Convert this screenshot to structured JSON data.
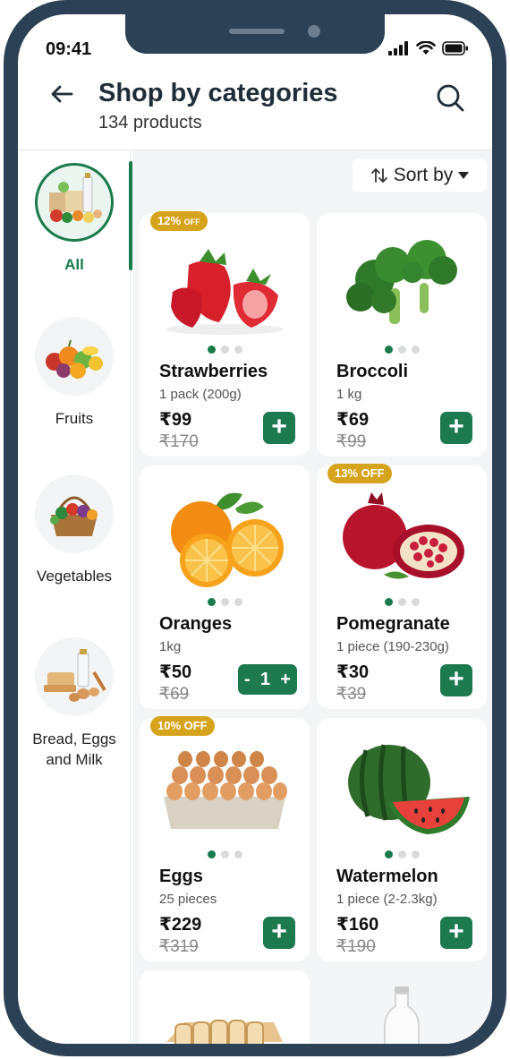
{
  "status": {
    "time": "09:41"
  },
  "header": {
    "title": "Shop by categories",
    "subtitle": "134 products"
  },
  "sidebar": {
    "items": [
      {
        "label": "All",
        "active": true
      },
      {
        "label": "Fruits",
        "active": false
      },
      {
        "label": "Vegetables",
        "active": false
      },
      {
        "label": "Bread, Eggs and Milk",
        "active": false
      }
    ]
  },
  "sort": {
    "label": "Sort by"
  },
  "products": [
    {
      "name": "Strawberries",
      "qty": "1 pack (200g)",
      "price": "₹99",
      "mrp": "₹170",
      "badge": "12%",
      "badge_suffix": "OFF"
    },
    {
      "name": "Broccoli",
      "qty": "1 kg",
      "price": "₹69",
      "mrp": "₹99",
      "badge": ""
    },
    {
      "name": "Oranges",
      "qty": "1kg",
      "price": "₹50",
      "mrp": "₹69",
      "badge": "",
      "cart_count": "1"
    },
    {
      "name": "Pomegranate",
      "qty": "1 piece (190-230g)",
      "price": "₹30",
      "mrp": "₹39",
      "badge": "13% OFF"
    },
    {
      "name": "Eggs",
      "qty": "25 pieces",
      "price": "₹229",
      "mrp": "₹319",
      "badge": "10% OFF"
    },
    {
      "name": "Watermelon",
      "qty": "1 piece (2-2.3kg)",
      "price": "₹160",
      "mrp": "₹190",
      "badge": ""
    }
  ],
  "colors": {
    "brand_green": "#1a7a4c",
    "badge_gold": "#d6a31d",
    "frame": "#2c4156"
  }
}
